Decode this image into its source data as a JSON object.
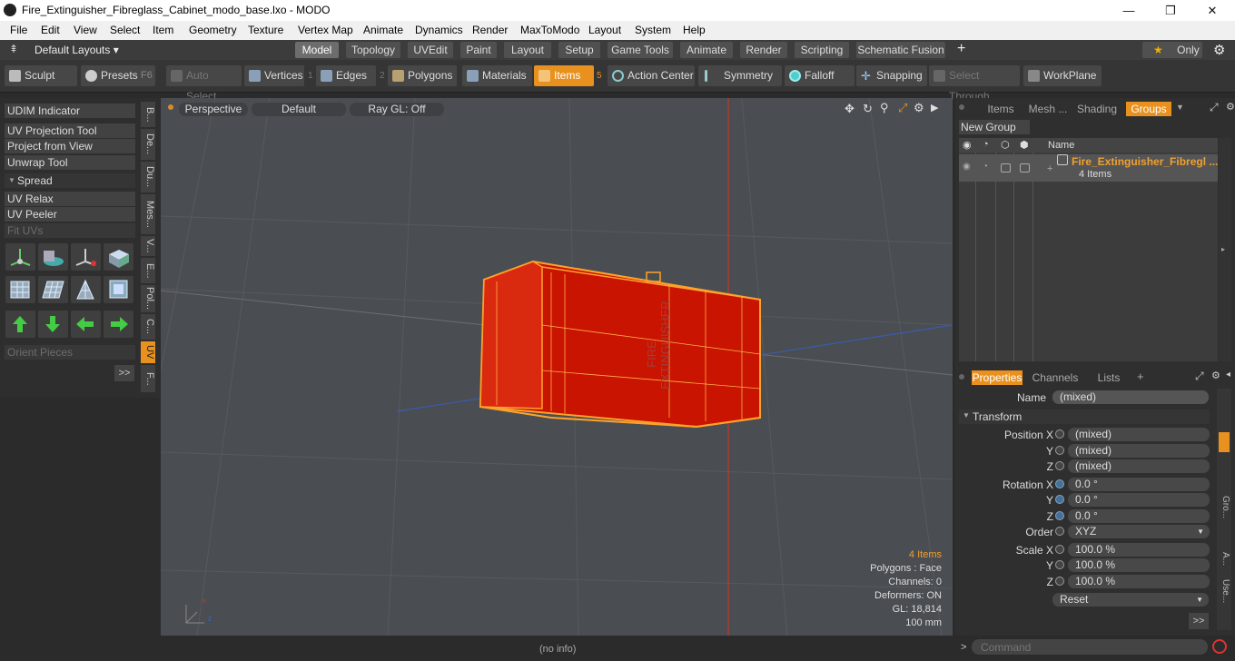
{
  "window": {
    "title": "Fire_Extinguisher_Fibreglass_Cabinet_modo_base.lxo - MODO",
    "minimize": "—",
    "maximize": "❐",
    "close": "✕"
  },
  "menu": [
    "File",
    "Edit",
    "View",
    "Select",
    "Item",
    "Geometry",
    "Texture",
    "Vertex Map",
    "Animate",
    "Dynamics",
    "Render",
    "MaxToModo",
    "Layout",
    "System",
    "Help"
  ],
  "layouts_label": "Default Layouts ▾",
  "tabs": [
    "Model",
    "Topology",
    "UVEdit",
    "Paint",
    "Layout",
    "Setup",
    "Game Tools",
    "Animate",
    "Render",
    "Scripting",
    "Schematic Fusion"
  ],
  "tab_add": "+",
  "only_label": "Only",
  "toolbar": {
    "sculpt": "Sculpt",
    "presets": "Presets",
    "presets_key": "F6",
    "auto_select": "Auto Select",
    "vertices": "Vertices",
    "vertices_num": "1",
    "edges": "Edges",
    "edges_num": "2",
    "polygons": "Polygons",
    "materials": "Materials",
    "items": "Items",
    "items_num": "5",
    "action_center": "Action Center",
    "symmetry": "Symmetry",
    "falloff": "Falloff",
    "snapping": "Snapping",
    "select_through": "Select Through",
    "workplane": "WorkPlane"
  },
  "left_tools": {
    "udim": "UDIM Indicator",
    "uv_projection": "UV Projection Tool",
    "project_from_view": "Project from View",
    "unwrap": "Unwrap Tool",
    "spread": "Spread",
    "uv_relax": "UV Relax",
    "uv_peeler": "UV Peeler",
    "fit_uvs": "Fit UVs",
    "orient_pieces": "Orient Pieces",
    "more": ">>"
  },
  "vtabs": [
    "B...",
    "De...",
    "Du...",
    "Mes...",
    "V...",
    "E...",
    "Pol...",
    "C...",
    "UV",
    "F..."
  ],
  "viewport": {
    "perspective": "Perspective",
    "default": "Default",
    "raygl": "Ray GL: Off",
    "label_line1": "FIRE",
    "label_line2": "EXTINGUISHER",
    "info": {
      "items": "4 Items",
      "polygons": "Polygons : Face",
      "channels": "Channels: 0",
      "deformers": "Deformers: ON",
      "gl": "GL: 18,814",
      "unit": "100 mm"
    }
  },
  "right_top": {
    "tabs": [
      "Items",
      "Mesh ...",
      "Shading",
      "Groups"
    ],
    "new_group": "New Group",
    "name_col": "Name",
    "group_name": "Fire_Extinguisher_Fibregl ...",
    "group_count": "4 Items"
  },
  "properties": {
    "tabs": [
      "Properties",
      "Channels",
      "Lists"
    ],
    "name_label": "Name",
    "name_value": "(mixed)",
    "transform": "Transform",
    "position_label": "Position X",
    "y": "Y",
    "z": "Z",
    "pos_x": "(mixed)",
    "pos_y": "(mixed)",
    "pos_z": "(mixed)",
    "rotation_label": "Rotation X",
    "rot_x": "0.0 °",
    "rot_y": "0.0 °",
    "rot_z": "0.0 °",
    "order_label": "Order",
    "order_value": "XYZ",
    "scale_label": "Scale X",
    "scale_x": "100.0 %",
    "scale_y": "100.0 %",
    "scale_z": "100.0 %",
    "reset": "Reset",
    "more": ">>",
    "side_tabs": [
      "Gro...",
      "A...",
      "Use..."
    ]
  },
  "status": {
    "info": "(no info)",
    "command_placeholder": "Command"
  },
  "colors": {
    "accent": "#e8911f",
    "cabinet": "#c81400",
    "wire": "#ffa22a"
  }
}
